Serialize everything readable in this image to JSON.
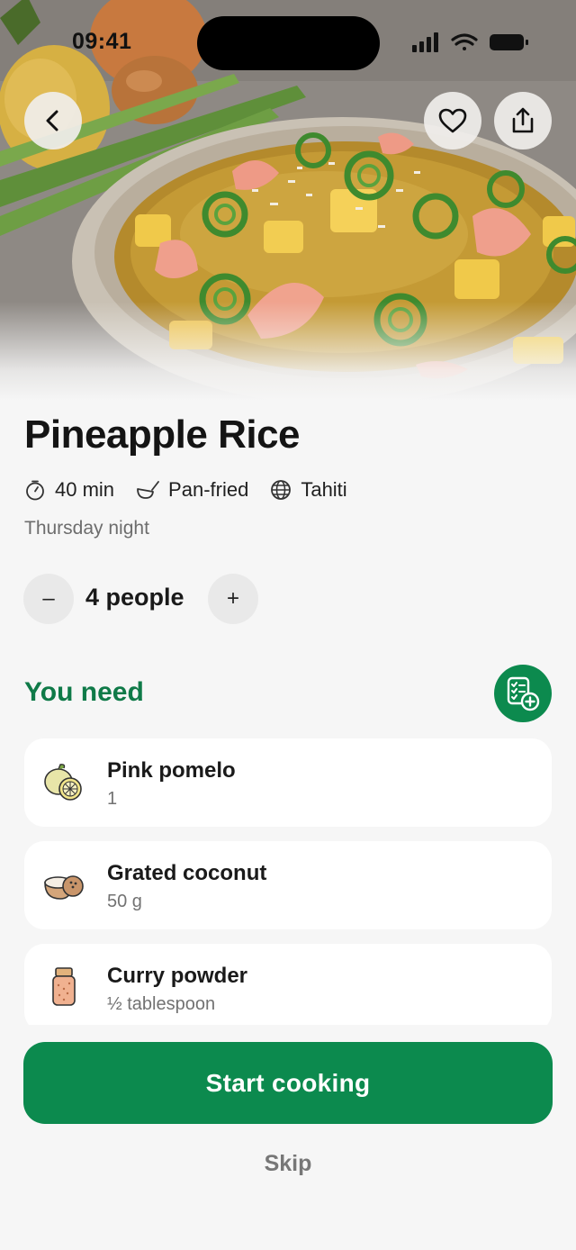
{
  "status_bar": {
    "time": "09:41"
  },
  "header": {
    "back_icon": "chevron-left-icon",
    "favorite_icon": "heart-outline-icon",
    "share_icon": "share-icon"
  },
  "recipe": {
    "title": "Pineapple Rice",
    "meta": [
      {
        "icon": "timer-icon",
        "label": "40 min"
      },
      {
        "icon": "pan-icon",
        "label": "Pan-fried"
      },
      {
        "icon": "globe-icon",
        "label": "Tahiti"
      }
    ],
    "subtitle": "Thursday night"
  },
  "servings": {
    "minus_label": "–",
    "value_label": "4 people",
    "plus_label": "+"
  },
  "ingredients_section": {
    "title": "You need",
    "add_to_list_icon": "checklist-add-icon",
    "items": [
      {
        "name": "Pink pomelo",
        "quantity": "1",
        "icon": "pomelo-icon"
      },
      {
        "name": "Grated coconut",
        "quantity": "50 g",
        "icon": "coconut-icon"
      },
      {
        "name": "Curry powder",
        "quantity": "½ tablespoon",
        "icon": "spice-jar-icon"
      }
    ]
  },
  "actions": {
    "start_label": "Start cooking",
    "skip_label": "Skip"
  },
  "colors": {
    "accent_green": "#0c8a4e",
    "section_title_green": "#0f7a48",
    "background": "#f6f6f6"
  }
}
